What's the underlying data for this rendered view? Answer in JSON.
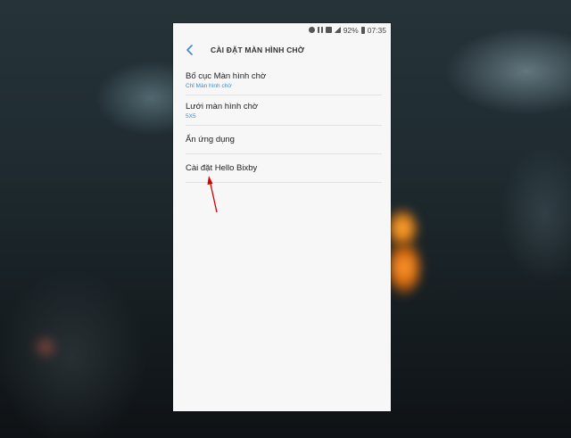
{
  "status_bar": {
    "battery_percent": "92%",
    "time": "07:35",
    "icons": [
      "alarm-icon",
      "wifi-icon",
      "sim-icon",
      "signal-icon",
      "battery-icon"
    ]
  },
  "header": {
    "title": "CÀI ĐẶT MÀN HÌNH CHỜ",
    "back_icon": "chevron-left-icon"
  },
  "settings": {
    "items": [
      {
        "title": "Bố cục Màn hình chờ",
        "subtitle": "Chỉ Màn hình chờ"
      },
      {
        "title": "Lưới màn hình chờ",
        "subtitle": "5X5"
      },
      {
        "title": "Ẩn ứng dụng"
      },
      {
        "title": "Cài đặt Hello Bixby"
      }
    ]
  },
  "colors": {
    "accent": "#3a8ccf",
    "annotation_arrow": "#d40000",
    "screen_bg": "#f7f7f7"
  }
}
